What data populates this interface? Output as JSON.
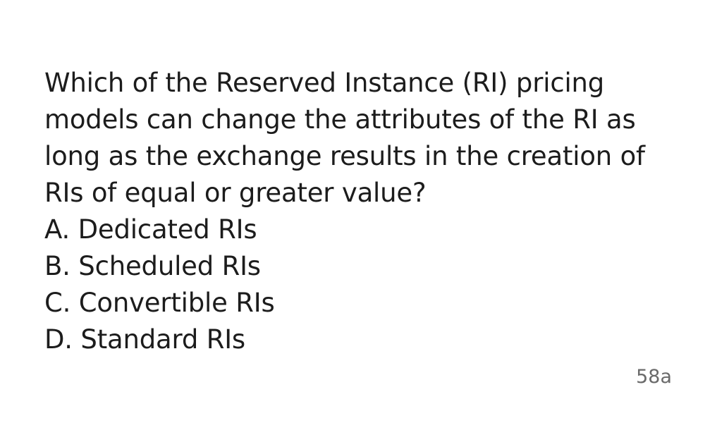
{
  "question": {
    "lines": [
      "Which of the Reserved Instance (RI) pricing",
      "models can change the attributes of the RI as",
      "long as the exchange results in the creation of",
      "RIs of equal or greater value?"
    ]
  },
  "options": [
    "A. Dedicated RIs",
    "B. Scheduled RIs",
    "C. Convertible RIs",
    "D. Standard RIs"
  ],
  "card_id": "58a"
}
